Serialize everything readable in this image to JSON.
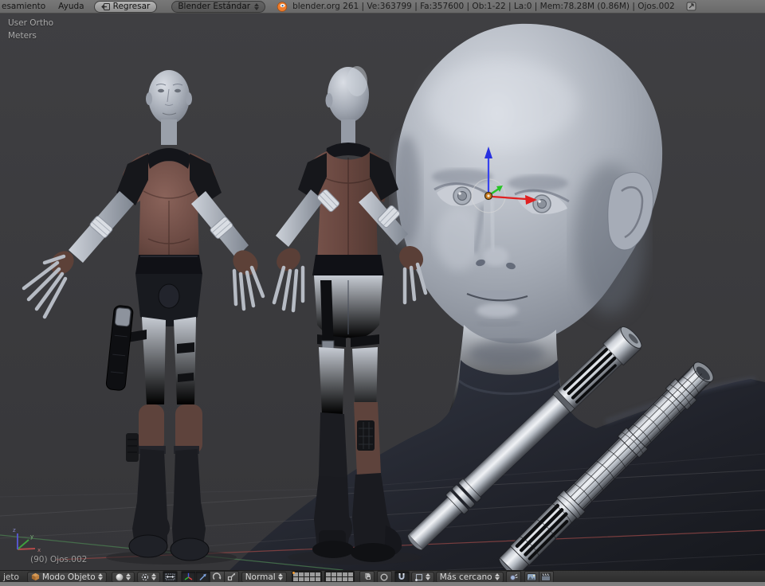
{
  "header": {
    "menu_partial": "esamiento",
    "help_menu": "Ayuda",
    "back_button": "Regresar",
    "preset_dropdown": "Blender Estándar",
    "stats": "blender.org 261 | Ve:363799 | Fa:357600 | Ob:1-22 | La:0 | Mem:78.28M (0.86M) | Ojos.002"
  },
  "viewport": {
    "view_label": "User Ortho",
    "units_label": "Meters",
    "object_label": "(90) Ojos.002"
  },
  "toolbar": {
    "menu_partial": "jeto",
    "mode_dropdown": "Modo Objeto",
    "orientation_dropdown": "Normal",
    "snap_target_dropdown": "Más cercano"
  },
  "icons": {
    "logo": "blender-logo",
    "back": "back-arrow",
    "expand": "expand-corner",
    "mode": "cube",
    "shading": "sphere",
    "pivot": "pivot-center",
    "manipulator_center": "move-centers",
    "manipulator": "axis-tripod",
    "translate": "translate-arrow",
    "rotate": "rotate-arc",
    "scale": "scale-box",
    "layers": "layer-grid",
    "lock": "lock-cube",
    "proportional": "proportional-circle",
    "snap": "magnet",
    "snap_element": "snap-element",
    "snap_align": "snap-align",
    "render_still": "opengl-render",
    "render_anim": "opengl-render-anim"
  },
  "layers": {
    "blocks": 2,
    "cells_per_block": 10,
    "dot_cell_index": 0
  },
  "colors": {
    "header_bg": "#6f6f6f",
    "toolbar_bg": "#2f2f2f",
    "viewport_bg": "#3a3a3c",
    "accent_orange": "#e8912d",
    "axis_x": "#dd3333",
    "axis_y": "#33cc33",
    "axis_z": "#4444ee",
    "tunic_brown": "#6e4c45",
    "skin_silver": "#a9afb9"
  }
}
